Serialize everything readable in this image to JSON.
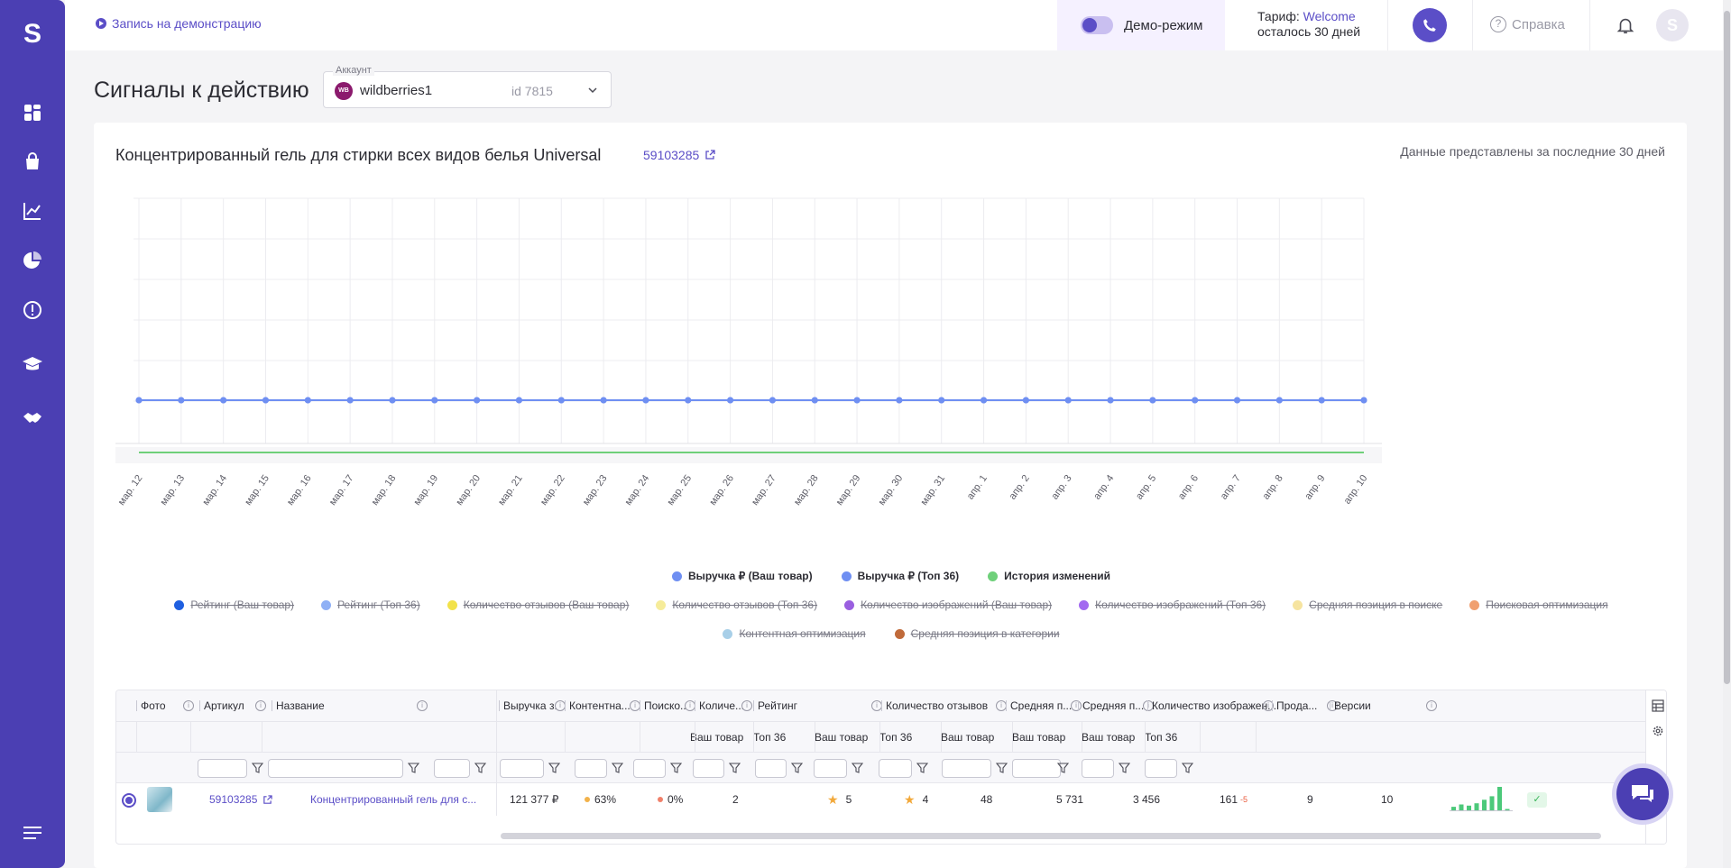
{
  "topbar": {
    "demo_link": "Запись на демонстрацию",
    "demo_mode_label": "Демо-режим",
    "tariff_prefix": "Тариф: ",
    "tariff_name": "Welcome",
    "tariff_remaining": "осталось 30 дней",
    "help_label": "Справка",
    "avatar_letter": "S"
  },
  "sidebar": {
    "logo": "S",
    "items": [
      "dashboard-icon",
      "shopping-bag-icon",
      "line-chart-icon",
      "pie-chart-icon",
      "alert-icon",
      "graduation-cap-icon",
      "handshake-icon"
    ]
  },
  "page": {
    "title": "Сигналы к действию",
    "account_caption": "Аккаунт",
    "account_badge": "WB",
    "account_name": "wildberries1",
    "account_id": "id 7815"
  },
  "product": {
    "title": "Концентрированный гель для стирки всех видов белья Universal",
    "sku": "59103285",
    "period": "Данные представлены за последние 30 дней"
  },
  "chart_data": {
    "type": "line",
    "x": [
      "мар. 12",
      "мар. 13",
      "мар. 14",
      "мар. 15",
      "мар. 16",
      "мар. 17",
      "мар. 18",
      "мар. 19",
      "мар. 20",
      "мар. 21",
      "мар. 22",
      "мар. 23",
      "мар. 24",
      "мар. 25",
      "мар. 26",
      "мар. 27",
      "мар. 28",
      "мар. 29",
      "мар. 30",
      "мар. 31",
      "апр. 1",
      "апр. 2",
      "апр. 3",
      "апр. 4",
      "апр. 5",
      "апр. 6",
      "апр. 7",
      "апр. 8",
      "апр. 9",
      "апр. 10"
    ],
    "series": [
      {
        "name": "Выручка ₽ (Ваш товар)",
        "color": "#6f8ff2",
        "values": [
          0,
          0,
          0,
          0,
          0,
          0,
          0,
          0,
          0,
          0,
          0,
          0,
          0,
          0,
          0,
          0,
          0,
          0,
          0,
          0,
          0,
          0,
          0,
          0,
          0,
          0,
          0,
          0,
          0,
          0
        ]
      },
      {
        "name": "Выручка ₽ (Топ 36)",
        "color": "#6f8ff2",
        "values": [
          0,
          0,
          0,
          0,
          0,
          0,
          0,
          0,
          0,
          0,
          0,
          0,
          0,
          0,
          0,
          0,
          0,
          0,
          0,
          0,
          0,
          0,
          0,
          0,
          0,
          0,
          0,
          0,
          0,
          0
        ]
      }
    ],
    "history_series": {
      "name": "История изменений",
      "color": "#6fd07a"
    },
    "grid": true
  },
  "legend": {
    "main": [
      {
        "label": "Выручка ₽ (Ваш товар)",
        "color": "#6f8ff2"
      },
      {
        "label": "Выручка ₽ (Топ 36)",
        "color": "#6f8ff2"
      },
      {
        "label": "История изменений",
        "color": "#6fd07a"
      }
    ],
    "disabled_row1": [
      {
        "label": "Рейтинг (Ваш товар)",
        "color": "#1f5fe0"
      },
      {
        "label": "Рейтинг (Топ 36)",
        "color": "#8fb0f5"
      },
      {
        "label": "Количество отзывов (Ваш товар)",
        "color": "#f2e24a"
      },
      {
        "label": "Количество отзывов (Топ 36)",
        "color": "#f6ec9a"
      },
      {
        "label": "Количество изображений (Ваш товар)",
        "color": "#9a5fe0"
      },
      {
        "label": "Количество изображений (Топ 36)",
        "color": "#a36af0"
      },
      {
        "label": "Средняя позиция в поиске",
        "color": "#f6e4a0"
      },
      {
        "label": "Поисковая оптимизация",
        "color": "#f0a070"
      }
    ],
    "disabled_row2": [
      {
        "label": "Контентная оптимизация",
        "color": "#a8cfe8"
      },
      {
        "label": "Средняя позиция в категории",
        "color": "#c06a3a"
      }
    ]
  },
  "table": {
    "headers": [
      "Фото",
      "Артикул",
      "Название",
      "Выручка з...",
      "Контентна...",
      "Поиско...",
      "Количе...",
      "Рейтинг",
      "Количество отзывов",
      "Средняя п...",
      "Средняя п...",
      "Количество изображен...",
      "Прода...",
      "Версии"
    ],
    "subheaders": {
      "your": "Ваш товар",
      "top": "Топ 36"
    },
    "row": {
      "sku": "59103285",
      "name": "Концентрированный гель для с...",
      "revenue": "121 377 ₽",
      "content_opt": "63%",
      "content_opt_color": "#f2b24a",
      "search_opt": "0%",
      "search_opt_color": "#f0806a",
      "count": "2",
      "rating_your": "5",
      "rating_top": "4",
      "reviews_your": "48",
      "reviews_top": "5 731",
      "avg_search": "3 456",
      "avg_cat_your": "161",
      "avg_cat_delta": "-5",
      "images_your": "9",
      "images_top": "10",
      "sales_bars": [
        0.15,
        0.25,
        0.2,
        0.3,
        0.45,
        0.6,
        1.0,
        0.05
      ],
      "version_check": "✓"
    }
  }
}
